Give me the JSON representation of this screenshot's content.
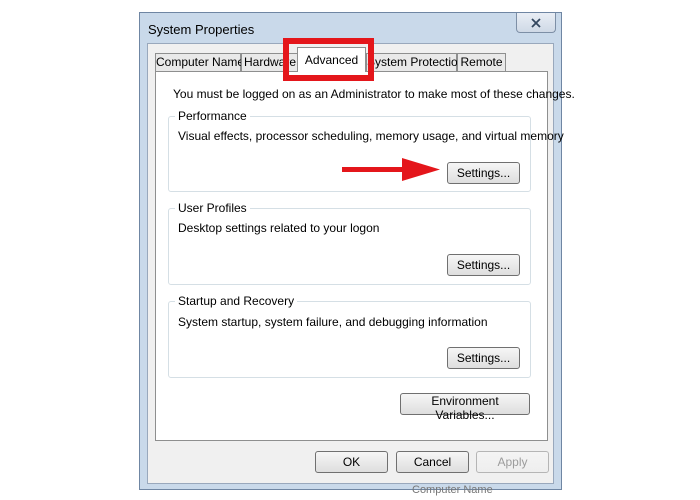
{
  "window": {
    "title": "System Properties",
    "close_icon": "close-icon"
  },
  "tabs": [
    {
      "label": "Computer Name",
      "active": false
    },
    {
      "label": "Hardware",
      "active": false
    },
    {
      "label": "Advanced",
      "active": true
    },
    {
      "label": "System Protection",
      "active": false
    },
    {
      "label": "Remote",
      "active": false
    }
  ],
  "admin_notice": "You must be logged on as an Administrator to make most of these changes.",
  "groups": {
    "performance": {
      "title": "Performance",
      "description": "Visual effects, processor scheduling, memory usage, and virtual memory",
      "button": "Settings..."
    },
    "user_profiles": {
      "title": "User Profiles",
      "description": "Desktop settings related to your logon",
      "button": "Settings..."
    },
    "startup_recovery": {
      "title": "Startup and Recovery",
      "description": "System startup, system failure, and debugging information",
      "button": "Settings..."
    }
  },
  "env_button": "Environment Variables...",
  "dialog_buttons": {
    "ok": "OK",
    "cancel": "Cancel",
    "apply": "Apply"
  },
  "annotation": {
    "color": "#e4161b",
    "highlight_target": "Advanced",
    "arrow_target": "Settings..."
  },
  "footer_fragment": "Computer Name"
}
